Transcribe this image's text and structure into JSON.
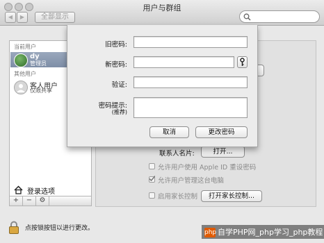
{
  "window": {
    "title": "用户与群组",
    "show_all": "全部显示"
  },
  "sidebar": {
    "section_current": "当前用户",
    "current_user": {
      "name": "dy",
      "role": "管理员"
    },
    "section_other": "其他用户",
    "guest_user": {
      "name": "客人用户",
      "role": "仅限共享"
    },
    "login_options": "登录选项",
    "buttons": [
      "+",
      "−",
      "⚙"
    ]
  },
  "panel": {
    "contact_card_label": "联系人名片:",
    "open_button": "打开...",
    "options": [
      {
        "label": "允许用户使用 Apple ID 重设密码",
        "checked": false
      },
      {
        "label": "允许用户管理这台电脑",
        "checked": true
      },
      {
        "label": "启用家长控制",
        "checked": false
      }
    ],
    "parental_button": "打开家长控制..."
  },
  "dialog": {
    "old_password_label": "旧密码:",
    "new_password_label": "新密码:",
    "verify_label": "验证:",
    "hint_label": "密码提示:",
    "hint_sub": "(推荐)",
    "cancel": "取消",
    "change": "更改密码",
    "old_password_value": "",
    "new_password_value": "",
    "verify_value": "",
    "hint_value": ""
  },
  "footer": {
    "lock_text": "点按锁按钮以进行更改。"
  },
  "watermark": {
    "logo": "php",
    "text": "自学PHP网_php学习_php教程"
  }
}
